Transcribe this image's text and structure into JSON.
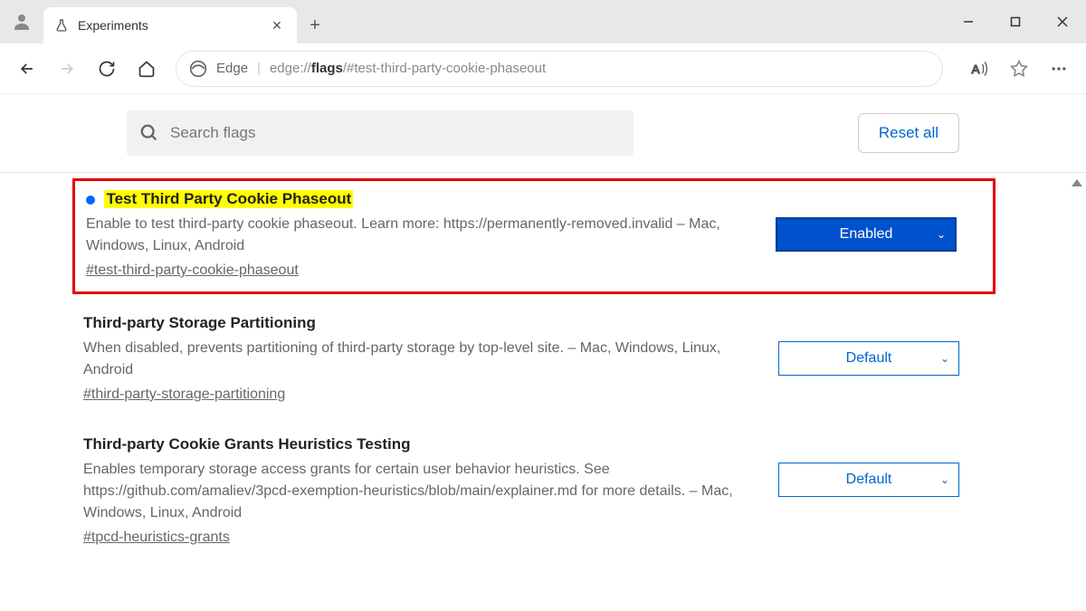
{
  "tab": {
    "title": "Experiments"
  },
  "addressbar": {
    "edge_label": "Edge",
    "url_prefix": "edge://",
    "url_bold": "flags",
    "url_suffix": "/#test-third-party-cookie-phaseout"
  },
  "search": {
    "placeholder": "Search flags",
    "reset_label": "Reset all"
  },
  "flags": [
    {
      "title": "Test Third Party Cookie Phaseout",
      "description": "Enable to test third-party cookie phaseout. Learn more: https://permanently-removed.invalid – Mac, Windows, Linux, Android",
      "anchor": "#test-third-party-cookie-phaseout",
      "select_value": "Enabled",
      "highlighted": true,
      "has_dot": true
    },
    {
      "title": "Third-party Storage Partitioning",
      "description": "When disabled, prevents partitioning of third-party storage by top-level site. – Mac, Windows, Linux, Android",
      "anchor": "#third-party-storage-partitioning",
      "select_value": "Default",
      "highlighted": false,
      "has_dot": false
    },
    {
      "title": "Third-party Cookie Grants Heuristics Testing",
      "description": "Enables temporary storage access grants for certain user behavior heuristics. See https://github.com/amaliev/3pcd-exemption-heuristics/blob/main/explainer.md for more details. – Mac, Windows, Linux, Android",
      "anchor": "#tpcd-heuristics-grants",
      "select_value": "Default",
      "highlighted": false,
      "has_dot": false
    }
  ]
}
